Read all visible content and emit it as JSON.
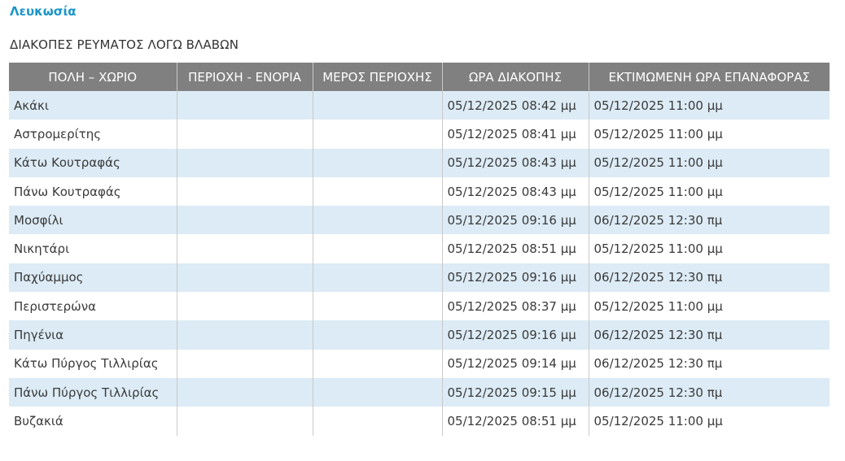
{
  "region": {
    "name": "Λευκωσία",
    "color": "#1a95c9"
  },
  "table": {
    "title": "ΔΙΑΚΟΠΕΣ ΡΕΥΜΑΤΟΣ ΛΟΓΩ ΒΛΑΒΩΝ",
    "header_bg": "#808080",
    "row_stripe_color": "#dcebf5",
    "columns": [
      "ΠΟΛΗ – ΧΩΡΙΟ",
      "ΠΕΡΙΟΧΗ - ΕΝΟΡΙΑ",
      "ΜΕΡΟΣ ΠΕΡΙΟΧΗΣ",
      "ΩΡΑ ΔΙΑΚΟΠΗΣ",
      "ΕΚΤΙΜΩΜΕΝΗ ΩΡΑ ΕΠΑΝΑΦΟΡΑΣ"
    ],
    "rows": [
      [
        "Ακάκι",
        "",
        "",
        "05/12/2025 08:42 μμ",
        "05/12/2025 11:00 μμ"
      ],
      [
        "Αστρομερίτης",
        "",
        "",
        "05/12/2025 08:41 μμ",
        "05/12/2025 11:00 μμ"
      ],
      [
        "Κάτω Κουτραφάς",
        "",
        "",
        "05/12/2025 08:43 μμ",
        "05/12/2025 11:00 μμ"
      ],
      [
        "Πάνω Κουτραφάς",
        "",
        "",
        "05/12/2025 08:43 μμ",
        "05/12/2025 11:00 μμ"
      ],
      [
        "Μοσφίλι",
        "",
        "",
        "05/12/2025 09:16 μμ",
        "06/12/2025 12:30 πμ"
      ],
      [
        "Νικητάρι",
        "",
        "",
        "05/12/2025 08:51 μμ",
        "05/12/2025 11:00 μμ"
      ],
      [
        "Παχύαμμος",
        "",
        "",
        "05/12/2025 09:16 μμ",
        "06/12/2025 12:30 πμ"
      ],
      [
        "Περιστερώνα",
        "",
        "",
        "05/12/2025 08:37 μμ",
        "05/12/2025 11:00 μμ"
      ],
      [
        "Πηγένια",
        "",
        "",
        "05/12/2025 09:16 μμ",
        "06/12/2025 12:30 πμ"
      ],
      [
        "Κάτω Πύργος Τιλλιρίας",
        "",
        "",
        "05/12/2025 09:14 μμ",
        "06/12/2025 12:30 πμ"
      ],
      [
        "Πάνω Πύργος Τιλλιρίας",
        "",
        "",
        "05/12/2025 09:15 μμ",
        "06/12/2025 12:30 πμ"
      ],
      [
        "Βυζακιά",
        "",
        "",
        "05/12/2025 08:51 μμ",
        "05/12/2025 11:00 μμ"
      ]
    ]
  }
}
